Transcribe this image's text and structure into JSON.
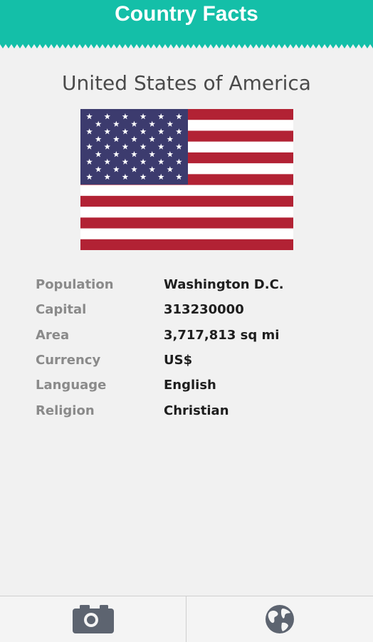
{
  "header": {
    "title": "Country Facts",
    "color": "#14bfa8"
  },
  "country": {
    "name": "United States of America"
  },
  "flag": {
    "icon": "us-flag"
  },
  "facts": [
    {
      "label": "Population",
      "value": "Washington D.C."
    },
    {
      "label": "Capital",
      "value": "313230000"
    },
    {
      "label": "Area",
      "value": "3,717,813 sq mi"
    },
    {
      "label": "Currency",
      "value": "US$"
    },
    {
      "label": "Language",
      "value": "English"
    },
    {
      "label": "Religion",
      "value": "Christian"
    }
  ],
  "bottom_nav": [
    {
      "icon": "camera-icon"
    },
    {
      "icon": "globe-icon"
    }
  ]
}
